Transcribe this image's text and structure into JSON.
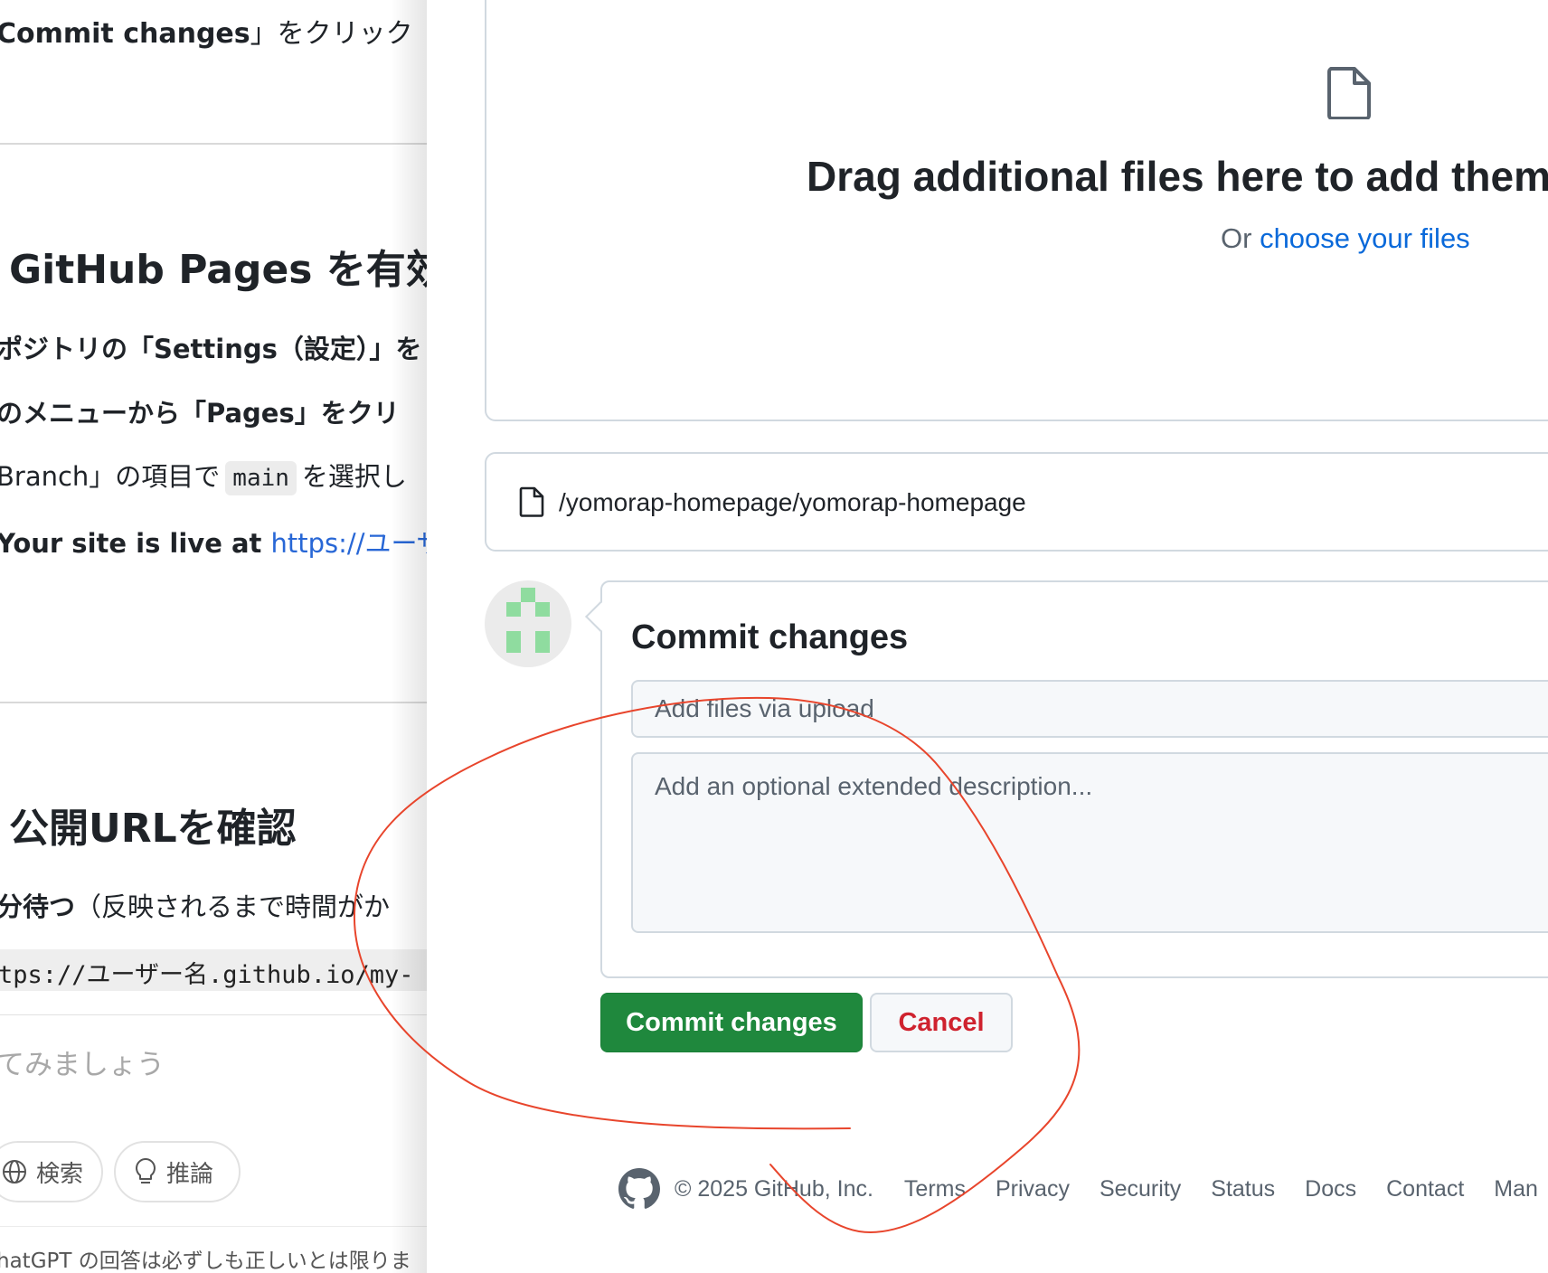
{
  "left_panel": {
    "step_line_bold": "Commit changes",
    "step_line_rest": "」をクリック",
    "heading_pages": "GitHub Pages を有効",
    "bullet_settings": "ポジトリの「Settings（設定）」を",
    "bullet_menu": "のメニューから「Pages」をクリ",
    "bullet_branch_pre": "Branch」の項目で",
    "bullet_branch_code": "main",
    "bullet_branch_post": "を選択し",
    "bullet_live_bold": "Your site is live at ",
    "bullet_live_link": "https://ユーザー",
    "heading_url": "公開URLを確認",
    "wait_bold": "分待つ",
    "wait_rest": "（反映されるまで時間がか",
    "url_code": "tps://ユーザー名.github.io/my-",
    "composer_placeholder": "てみましょう",
    "search_label": "検索",
    "reason_label": "推論",
    "disclaimer": "hatGPT の回答は必ずしも正しいとは限りま"
  },
  "upload": {
    "drag_title": "Drag additional files here to add them",
    "or_text": "Or ",
    "choose_link": "choose your files",
    "path": "/yomorap-homepage/yomorap-homepage"
  },
  "commit": {
    "title": "Commit changes",
    "summary_placeholder": "Add files via upload",
    "description_placeholder": "Add an optional extended description...",
    "commit_button": "Commit changes",
    "cancel_button": "Cancel"
  },
  "footer": {
    "copyright": "© 2025 GitHub, Inc.",
    "links": [
      "Terms",
      "Privacy",
      "Security",
      "Status",
      "Docs",
      "Contact",
      "Man"
    ]
  },
  "colors": {
    "commit_green": "#1f883d",
    "cancel_red": "#cf222e",
    "link_blue": "#0969da",
    "annotation_red": "#e8452c"
  }
}
